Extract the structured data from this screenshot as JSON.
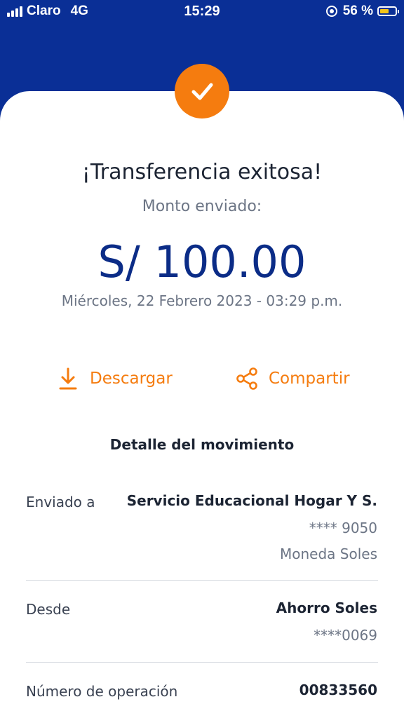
{
  "status_bar": {
    "carrier": "Claro",
    "network": "4G",
    "time": "15:29",
    "battery_percent": "56 %",
    "battery_color": "#f5c518"
  },
  "header": {
    "bg_color": "#0a2f96",
    "success_icon": "check-icon",
    "accent": "#f57c0f"
  },
  "main": {
    "title": "¡Transferencia exitosa!",
    "subtitle": "Monto enviado:",
    "amount": "S/ 100.00",
    "datetime": "Miércoles, 22 Febrero 2023 - 03:29 p.m."
  },
  "actions": {
    "download": {
      "label": "Descargar",
      "icon": "download-icon"
    },
    "share": {
      "label": "Compartir",
      "icon": "share-icon"
    }
  },
  "detail": {
    "title": "Detalle del movimiento",
    "sent_to": {
      "label": "Enviado a",
      "name": "Servicio Educacional Hogar Y S.",
      "account": "**** 9050",
      "currency": "Moneda Soles"
    },
    "from": {
      "label": "Desde",
      "account_name": "Ahorro Soles",
      "account_number": "****0069"
    },
    "operation": {
      "label": "Número de operación",
      "value": "00833560"
    }
  }
}
